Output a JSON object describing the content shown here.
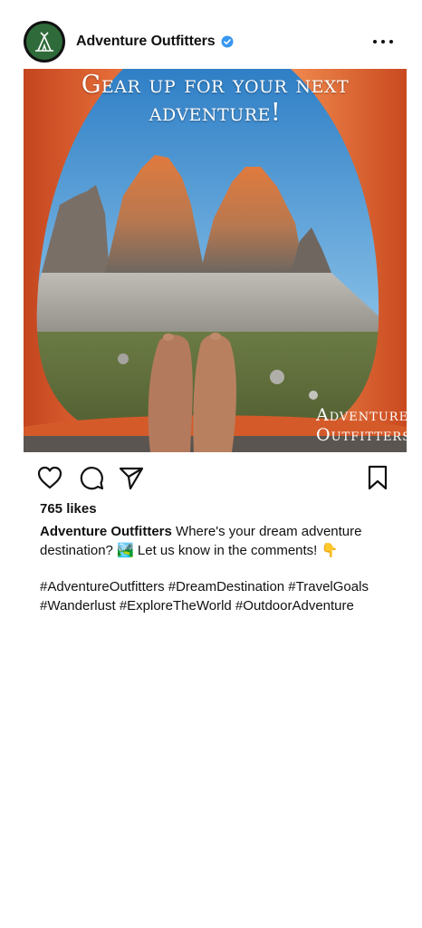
{
  "header": {
    "username": "Adventure Outfitters",
    "verified": true,
    "avatar_icon": "tent-logo-icon",
    "avatar_color": "#2f6b3a"
  },
  "post": {
    "image_headline": "Gear up for your next adventure!",
    "image_watermark_line1": "Adventure",
    "image_watermark_line2": "Outfitters",
    "image_description_icon": "tent-mountain-photo"
  },
  "actions": {
    "like_icon": "heart-icon",
    "comment_icon": "comment-icon",
    "share_icon": "send-icon",
    "save_icon": "bookmark-icon"
  },
  "likes": "765 likes",
  "caption": {
    "username": "Adventure Outfitters",
    "text": "Where's your dream adventure destination? 🏞️ Let us know in the comments! 👇",
    "hashtags": "#AdventureOutfitters #DreamDestination #TravelGoals #Wanderlust #ExploreTheWorld #OutdoorAdventure"
  },
  "colors": {
    "accent_verified": "#3897f0",
    "text": "#111111",
    "background": "#ffffff"
  }
}
